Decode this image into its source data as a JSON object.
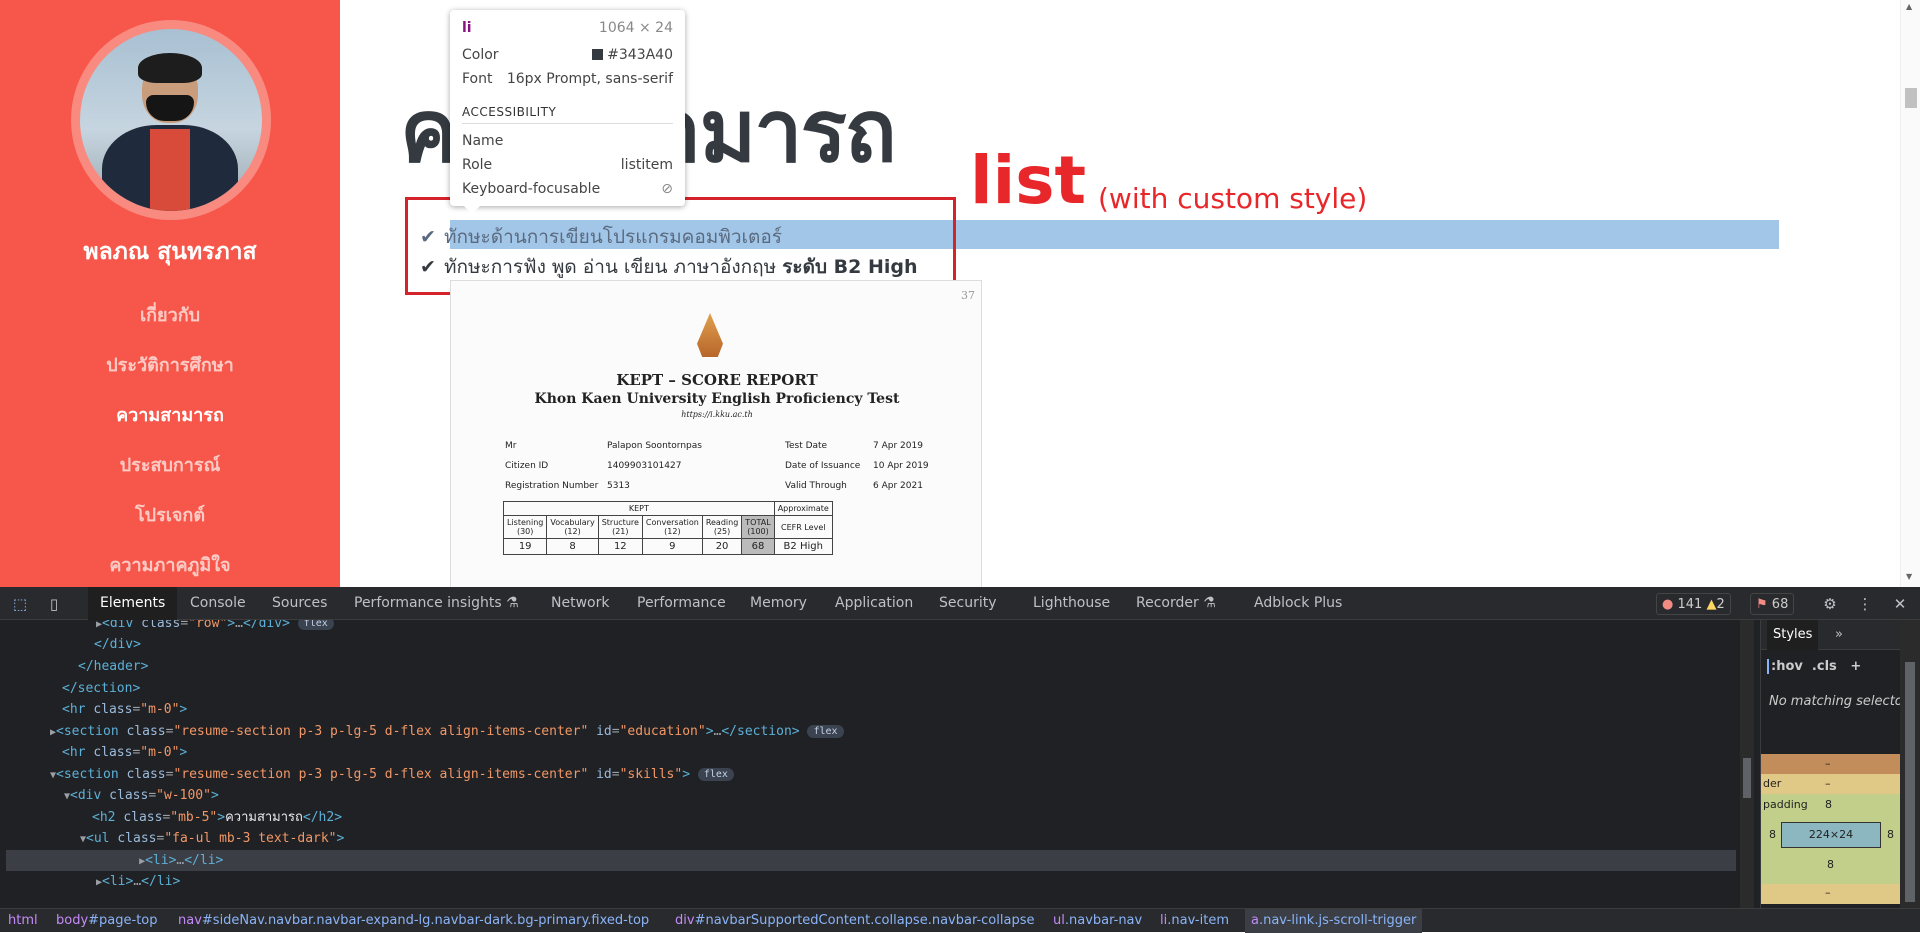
{
  "sidebar": {
    "name": "พลภณ สุนทรภาส",
    "nav": [
      "เกี่ยวกับ",
      "ประวัติการศึกษา",
      "ความสามารถ",
      "ประสบการณ์",
      "โปรเจกต์",
      "ความภาคภูมิใจ"
    ],
    "active_index": 2
  },
  "main": {
    "heading": "ความสามารถ",
    "overlay_title": "list",
    "overlay_subtitle": "(with custom style)",
    "list": [
      {
        "text": "ทักษะด้านการเขียนโปรแกรมคอมพิวเตอร์"
      },
      {
        "text": "ทักษะการฟัง พูด อ่าน เขียน ภาษาอังกฤษ ",
        "bold": "ระดับ B2 High"
      }
    ]
  },
  "certificate": {
    "page_no": "37",
    "title": "KEPT – SCORE REPORT",
    "subtitle": "Khon Kaen University English Proficiency Test",
    "url": "https://i.kku.ac.th",
    "fields": {
      "prefix": "Mr",
      "name": "Palapon Soontornpas",
      "test_date_label": "Test Date",
      "test_date": "7 Apr 2019",
      "citizen_label": "Citizen ID",
      "citizen": "1409903101427",
      "issuance_label": "Date of Issuance",
      "issuance": "10 Apr 2019",
      "reg_label": "Registration Number",
      "reg": "5313",
      "valid_label": "Valid Through",
      "valid": "6 Apr 2021"
    },
    "table": {
      "group_header": "KEPT",
      "approx_header": "Approximate",
      "cefr_header": "CEFR Level",
      "columns": [
        "Listening",
        "Vocabulary",
        "Structure",
        "Conversation",
        "Reading",
        "TOTAL"
      ],
      "max": [
        "(30)",
        "(12)",
        "(21)",
        "(12)",
        "(25)",
        "(100)"
      ],
      "scores": [
        "19",
        "8",
        "12",
        "9",
        "20",
        "68"
      ],
      "cefr": "B2 High"
    }
  },
  "tooltip": {
    "tag": "li",
    "size": "1064 × 24",
    "color_label": "Color",
    "color_value": "#343A40",
    "font_label": "Font",
    "font_value": "16px Prompt, sans-serif",
    "section": "ACCESSIBILITY",
    "name_label": "Name",
    "name_value": "",
    "role_label": "Role",
    "role_value": "listitem",
    "keyboard_label": "Keyboard-focusable"
  },
  "devtools": {
    "tabs": [
      "Elements",
      "Console",
      "Sources",
      "Performance insights",
      "Network",
      "Performance",
      "Memory",
      "Application",
      "Security",
      "Lighthouse",
      "Recorder",
      "Adblock Plus"
    ],
    "active_tab": "Elements",
    "errors": "141",
    "warnings": "2",
    "issues": "68",
    "styles_tab": "Styles",
    "hov": ":hov",
    "cls": ".cls",
    "no_matching": "No matching selecto",
    "box": {
      "margin": "–",
      "border_label": "der",
      "border": "–",
      "padding_label": "padding",
      "padding": "8",
      "left": "8",
      "right": "8",
      "content": "224×24",
      "bottom": "8",
      "bottom2": "–"
    },
    "breadcrumbs": [
      {
        "tag": "html",
        "rest": ""
      },
      {
        "tag": "body",
        "rest": "#page-top"
      },
      {
        "tag": "nav",
        "rest": "#sideNav.navbar.navbar-expand-lg.navbar-dark.bg-primary.fixed-top"
      },
      {
        "tag": "div",
        "rest": "#navbarSupportedContent.collapse.navbar-collapse"
      },
      {
        "tag": "ul",
        "rest": ".navbar-nav"
      },
      {
        "tag": "li",
        "rest": ".nav-item"
      },
      {
        "tag": "a",
        "rest": ".nav-link.js-scroll-trigger"
      }
    ]
  }
}
